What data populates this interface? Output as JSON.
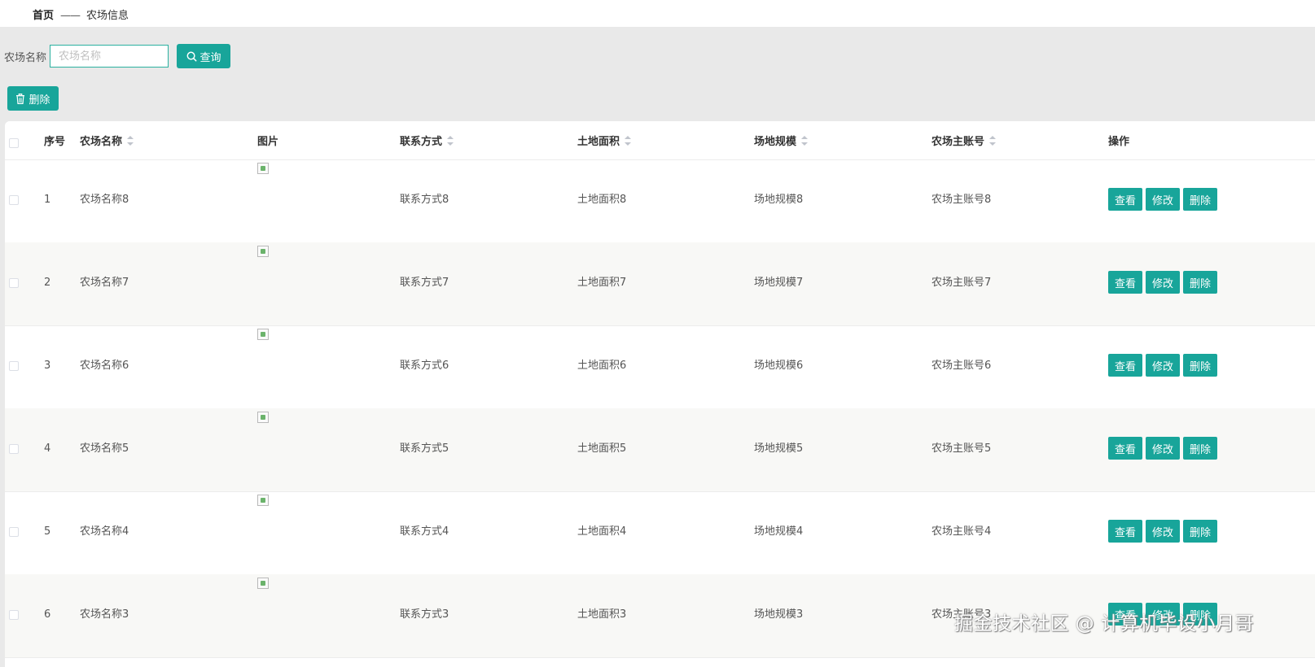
{
  "breadcrumb": {
    "home": "首页",
    "separator": "——",
    "current": "农场信息"
  },
  "search": {
    "label": "农场名称",
    "placeholder": "农场名称",
    "button": "查询"
  },
  "toolbar": {
    "delete_label": "删除"
  },
  "table": {
    "columns": {
      "index": "序号",
      "name": "农场名称",
      "image": "图片",
      "contact": "联系方式",
      "area": "土地面积",
      "scale": "场地规模",
      "account": "农场主账号",
      "actions": "操作"
    },
    "rows": [
      {
        "index": "1",
        "name": "农场名称8",
        "contact": "联系方式8",
        "area": "土地面积8",
        "scale": "场地规模8",
        "account": "农场主账号8"
      },
      {
        "index": "2",
        "name": "农场名称7",
        "contact": "联系方式7",
        "area": "土地面积7",
        "scale": "场地规模7",
        "account": "农场主账号7"
      },
      {
        "index": "3",
        "name": "农场名称6",
        "contact": "联系方式6",
        "area": "土地面积6",
        "scale": "场地规模6",
        "account": "农场主账号6"
      },
      {
        "index": "4",
        "name": "农场名称5",
        "contact": "联系方式5",
        "area": "土地面积5",
        "scale": "场地规模5",
        "account": "农场主账号5"
      },
      {
        "index": "5",
        "name": "农场名称4",
        "contact": "联系方式4",
        "area": "土地面积4",
        "scale": "场地规模4",
        "account": "农场主账号4"
      },
      {
        "index": "6",
        "name": "农场名称3",
        "contact": "联系方式3",
        "area": "土地面积3",
        "scale": "场地规模3",
        "account": "农场主账号3"
      }
    ],
    "row_actions": {
      "view": "查看",
      "edit": "修改",
      "delete": "删除"
    }
  },
  "watermark": "掘金技术社区 @ 计算机毕设小月哥",
  "colors": {
    "accent": "#18a59a",
    "input_border": "#2bb1a0",
    "page_bg": "#e9e9e9",
    "row_alt": "#f8f8f6"
  },
  "icons": {
    "search": "search-icon",
    "delete": "trash-icon",
    "image": "broken-image-icon"
  }
}
